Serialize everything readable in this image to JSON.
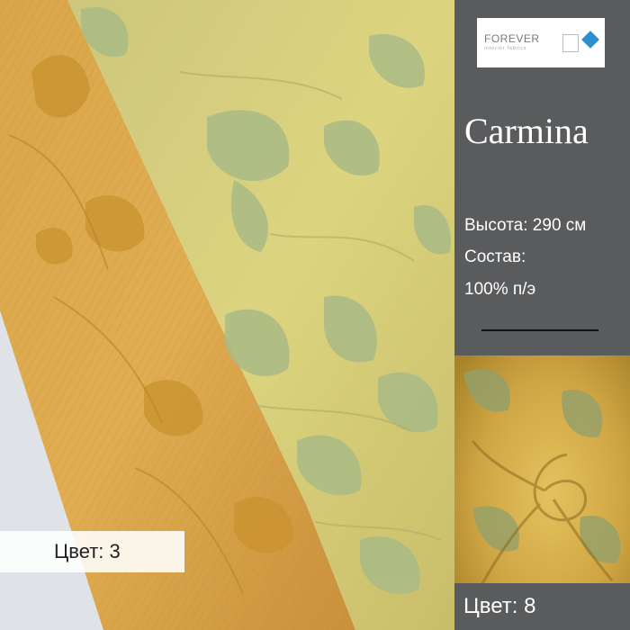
{
  "product": {
    "title": "Carmina",
    "height": "Высота: 290 см",
    "composition_label": "Состав:",
    "composition_value": "100% п/э"
  },
  "brand": {
    "name": "FOREVER",
    "tagline": "interior fabrics"
  },
  "swatches": {
    "left_label": "Цвет: 3",
    "right_label": "Цвет: 8"
  },
  "colors": {
    "panel": "#5a5b5d",
    "gold": "#d6a83e",
    "sage": "#d8cf7a",
    "leaf": "#a9bb86"
  }
}
